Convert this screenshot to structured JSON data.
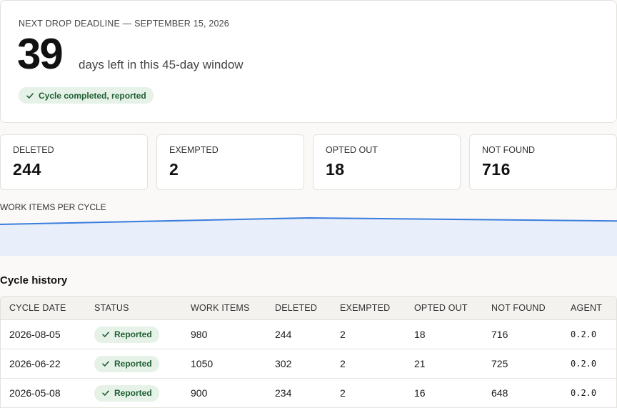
{
  "hero": {
    "eyebrow": "NEXT DROP DEADLINE — SEPTEMBER 15, 2026",
    "days_left": "39",
    "caption": "days left in this 45-day window",
    "status_badge": "Cycle completed, reported"
  },
  "stats": [
    {
      "label": "DELETED",
      "value": "244"
    },
    {
      "label": "EXEMPTED",
      "value": "2"
    },
    {
      "label": "OPTED OUT",
      "value": "18"
    },
    {
      "label": "NOT FOUND",
      "value": "716"
    }
  ],
  "sparkline": {
    "label": "WORK ITEMS PER CYCLE",
    "values_in_order": [
      900,
      1050,
      980
    ],
    "line_color": "#3b7ddd",
    "fill_color": "#e8effb"
  },
  "history": {
    "title": "Cycle history",
    "columns": [
      "CYCLE DATE",
      "STATUS",
      "WORK ITEMS",
      "DELETED",
      "EXEMPTED",
      "OPTED OUT",
      "NOT FOUND",
      "AGENT"
    ],
    "rows": [
      {
        "date": "2026-08-05",
        "status": "Reported",
        "work_items": "980",
        "deleted": "244",
        "exempted": "2",
        "opted_out": "18",
        "not_found": "716",
        "agent": "0.2.0"
      },
      {
        "date": "2026-06-22",
        "status": "Reported",
        "work_items": "1050",
        "deleted": "302",
        "exempted": "2",
        "opted_out": "21",
        "not_found": "725",
        "agent": "0.2.0"
      },
      {
        "date": "2026-05-08",
        "status": "Reported",
        "work_items": "900",
        "deleted": "234",
        "exempted": "2",
        "opted_out": "16",
        "not_found": "648",
        "agent": "0.2.0"
      }
    ]
  },
  "colors": {
    "badge_bg": "#e6f2e8",
    "badge_text": "#1f5f32",
    "page_bg": "#faf9f7"
  },
  "icons": {
    "status_check": "check-icon"
  }
}
